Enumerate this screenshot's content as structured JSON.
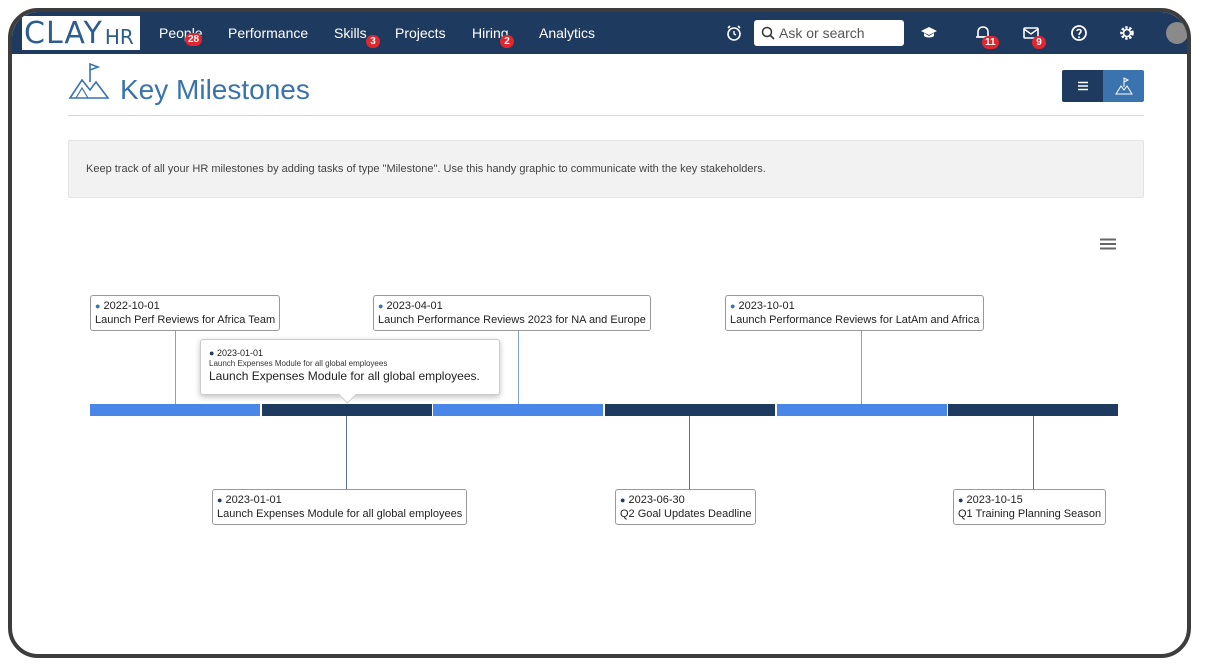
{
  "app": {
    "logo_main": "CLAY",
    "logo_sub": "HR"
  },
  "nav": {
    "items": [
      {
        "label": "People",
        "badge": "28"
      },
      {
        "label": "Performance",
        "badge": ""
      },
      {
        "label": "Skills",
        "badge": "3"
      },
      {
        "label": "Projects",
        "badge": ""
      },
      {
        "label": "Hiring",
        "badge": "2"
      },
      {
        "label": "Analytics",
        "badge": ""
      }
    ],
    "search_placeholder": "Ask or search",
    "notifications_badge": "11",
    "messages_badge": "9"
  },
  "page": {
    "title": "Key Milestones",
    "info": "Keep track of all your HR milestones by adding tasks of type \"Milestone\".  Use this handy graphic to communicate with the key stakeholders."
  },
  "timeline": {
    "top": [
      {
        "date": "2022-10-01",
        "label": "Launch Perf Reviews for Africa Team"
      },
      {
        "date": "2023-04-01",
        "label": "Launch Performance Reviews 2023 for NA and Europe"
      },
      {
        "date": "2023-10-01",
        "label": "Launch Performance Reviews for LatAm and Africa"
      }
    ],
    "bottom": [
      {
        "date": "2023-01-01",
        "label": "Launch Expenses Module for all global employees"
      },
      {
        "date": "2023-06-30",
        "label": "Q2 Goal Updates Deadline"
      },
      {
        "date": "2023-10-15",
        "label": "Q1 Training Planning Season"
      }
    ],
    "tooltip": {
      "date": "2023-01-01",
      "small": "Launch Expenses Module for all global employees",
      "big": "Launch Expenses Module for all global employees."
    }
  },
  "colors": {
    "nav_bg": "#1f3a5f",
    "accent": "#3a73ae",
    "segment_light": "#4a86e8",
    "segment_dark": "#1f3a5f",
    "badge": "#e0262e"
  }
}
